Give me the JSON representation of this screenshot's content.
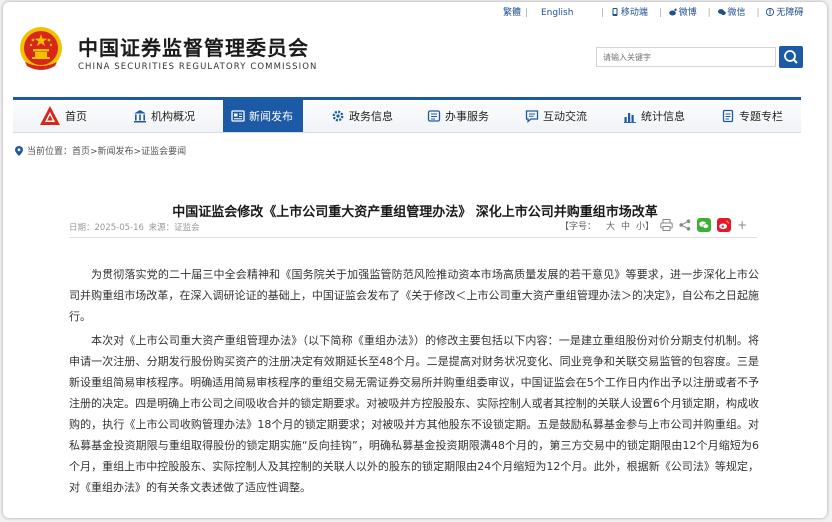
{
  "topbar": {
    "lang_traditional": "繁體",
    "lang_english": "English",
    "mobile": "移动端",
    "weibo": "微博",
    "wechat": "微信",
    "accessibility": "无障碍"
  },
  "header": {
    "title_cn": "中国证券监督管理委员会",
    "title_en": "CHINA SECURITIES REGULATORY COMMISSION",
    "search_placeholder": "请输入关键字"
  },
  "nav": {
    "items": [
      {
        "label": "首页",
        "icon": "home-icon"
      },
      {
        "label": "机构概况",
        "icon": "institution-icon"
      },
      {
        "label": "新闻发布",
        "icon": "news-icon",
        "active": true
      },
      {
        "label": "政务信息",
        "icon": "gear-icon"
      },
      {
        "label": "办事服务",
        "icon": "service-icon"
      },
      {
        "label": "互动交流",
        "icon": "chat-icon"
      },
      {
        "label": "统计信息",
        "icon": "chart-icon"
      },
      {
        "label": "专题专栏",
        "icon": "doc-icon"
      }
    ]
  },
  "breadcrumb": {
    "label": "当前位置：",
    "path": "首页>新闻发布>证监会要闻"
  },
  "article": {
    "title": "中国证监会修改《上市公司重大资产重组管理办法》 深化上市公司并购重组市场改革",
    "date_label": "日期：",
    "date": "2025-05-16",
    "source_label": "来源：",
    "source": "证监会",
    "font_size_label": "【字号：",
    "font_large": "大",
    "font_medium": "中",
    "font_small": "小】",
    "para1": "为贯彻落实党的二十届三中全会精神和《国务院关于加强监管防范风险推动资本市场高质量发展的若干意见》等要求，进一步深化上市公司并购重组市场改革，在深入调研论证的基础上，中国证监会发布了《关于修改＜上市公司重大资产重组管理办法＞的决定》，自公布之日起施行。",
    "para2": "本次对《上市公司重大资产重组管理办法》（以下简称《重组办法》）的修改主要包括以下内容：一是建立重组股份对价分期支付机制。将申请一次注册、分期发行股份购买资产的注册决定有效期延长至48个月。二是提高对财务状况变化、同业竞争和关联交易监管的包容度。三是新设重组简易审核程序。明确适用简易审核程序的重组交易无需证券交易所并购重组委审议，中国证监会在5个工作日内作出予以注册或者不予注册的决定。四是明确上市公司之间吸收合并的锁定期要求。对被吸并方控股股东、实际控制人或者其控制的关联人设置6个月锁定期，构成收购的，执行《上市公司收购管理办法》18个月的锁定期要求；对被吸并方其他股东不设锁定期。五是鼓励私募基金参与上市公司并购重组。对私募基金投资期限与重组取得股份的锁定期实施“反向挂钩”，明确私募基金投资期限满48个月的，第三方交易中的锁定期限由12个月缩短为6个月，重组上市中控股股东、实际控制人及其控制的关联人以外的股东的锁定期限由24个月缩短为12个月。此外，根据新《公司法》等规定，对《重组办法》的有关条文表述做了适应性调整。"
  },
  "colors": {
    "brand_blue": "#1d5aa6",
    "emblem_red": "#d9261c",
    "emblem_gold": "#f2c200"
  }
}
